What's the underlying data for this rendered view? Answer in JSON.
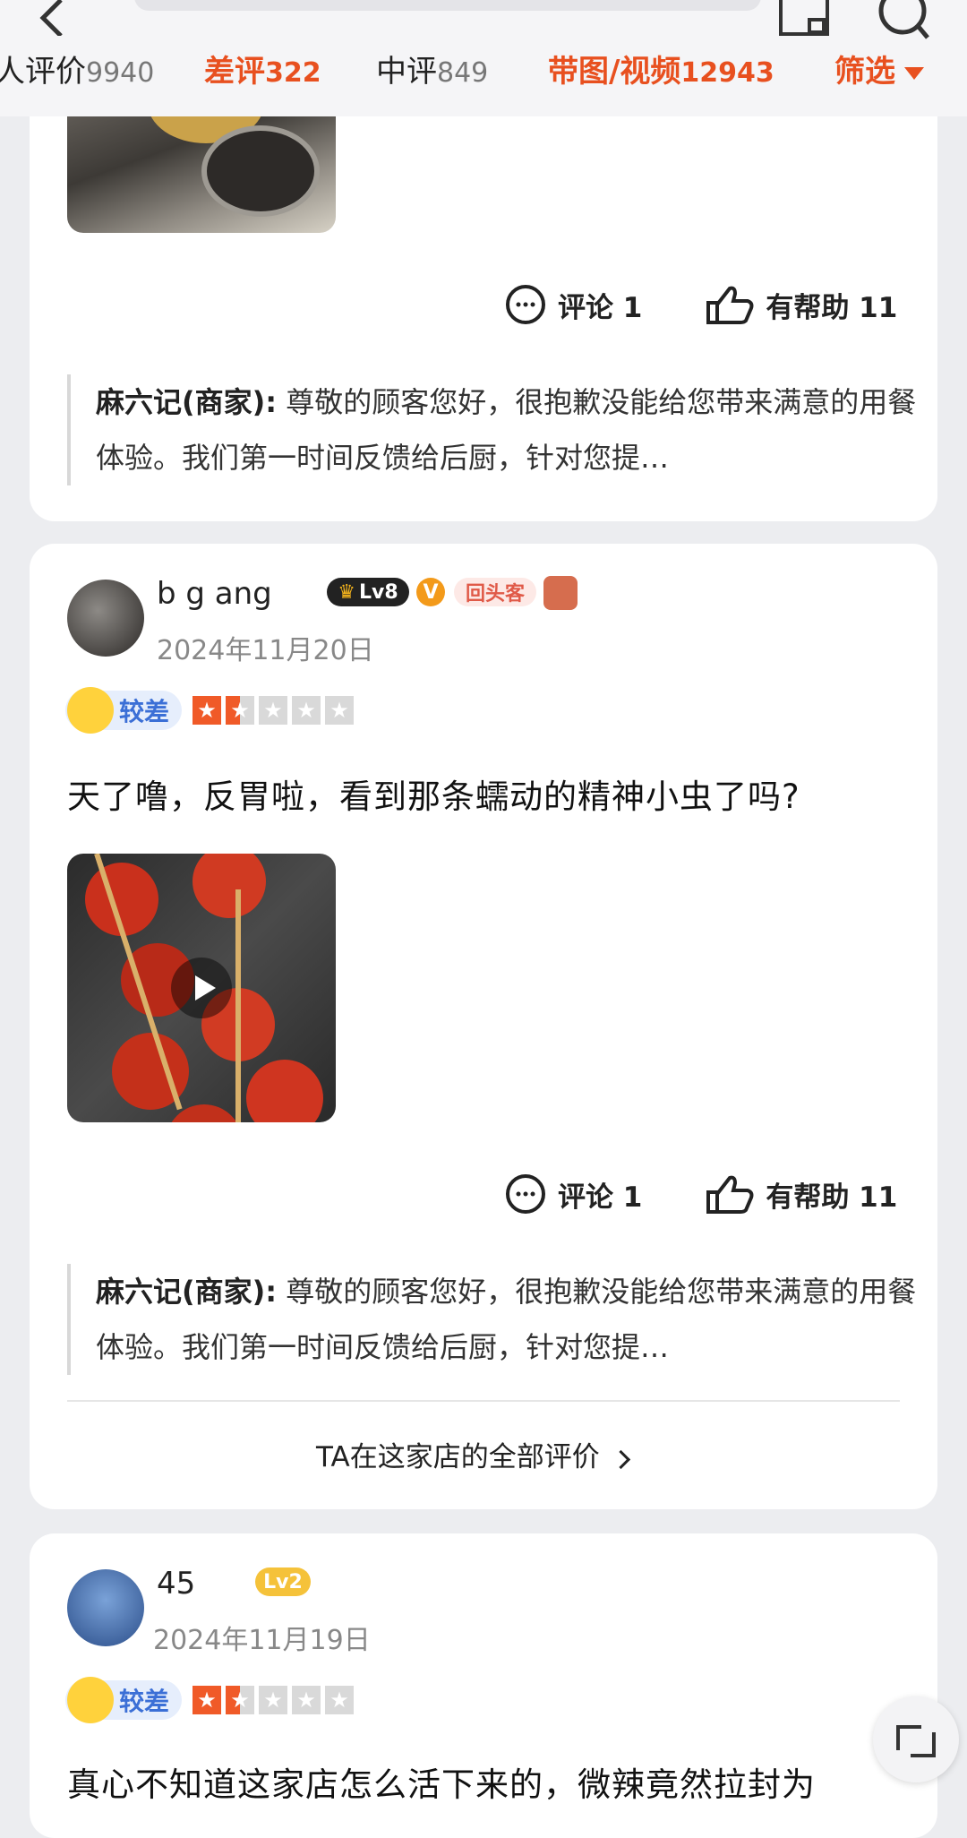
{
  "tabs": [
    {
      "label": "人评价",
      "count": "9940"
    },
    {
      "label": "差评",
      "count": "322"
    },
    {
      "label": "中评",
      "count": "849"
    },
    {
      "label": "带图/视频",
      "count": "12943"
    },
    {
      "label": "筛选"
    }
  ],
  "reviews": [
    {
      "actions": {
        "comment": "评论 1",
        "helpful": "有帮助 11"
      },
      "reply": {
        "merchant": "麻六记(商家):",
        "text": " 尊敬的顾客您好，很抱歉没能给您带来满意的用餐体验。我们第一时间反馈给后厨，针对您提…"
      }
    },
    {
      "username": "b      g  ang",
      "level": "Lv8",
      "badge_v": "V",
      "badge_return": "回头客",
      "date": "2024年11月20日",
      "rating_label": "较差",
      "stars": 1.5,
      "text": "天了噜，反胃啦，看到那条蠕动的精神小虫了吗?",
      "actions": {
        "comment": "评论 1",
        "helpful": "有帮助 11"
      },
      "reply": {
        "merchant": "麻六记(商家):",
        "text": " 尊敬的顾客您好，很抱歉没能给您带来满意的用餐体验。我们第一时间反馈给后厨，针对您提…"
      },
      "all_reviews_link": "TA在这家店的全部评价"
    },
    {
      "username": "  45",
      "level": "Lv2",
      "date": "2024年11月19日",
      "rating_label": "较差",
      "stars": 1.5,
      "text": "真心不知道这家店怎么活下来的，微辣竟然拉封为"
    }
  ],
  "colors": {
    "accent": "#e8501f",
    "star": "#f05a28",
    "rating": "#3b6fd6"
  },
  "icons": [
    "back-arrow-icon",
    "share-icon",
    "search-icon",
    "comment-icon",
    "thumbs-up-icon",
    "play-icon",
    "crown-icon",
    "chevron-right-icon",
    "scroll-top-icon"
  ]
}
